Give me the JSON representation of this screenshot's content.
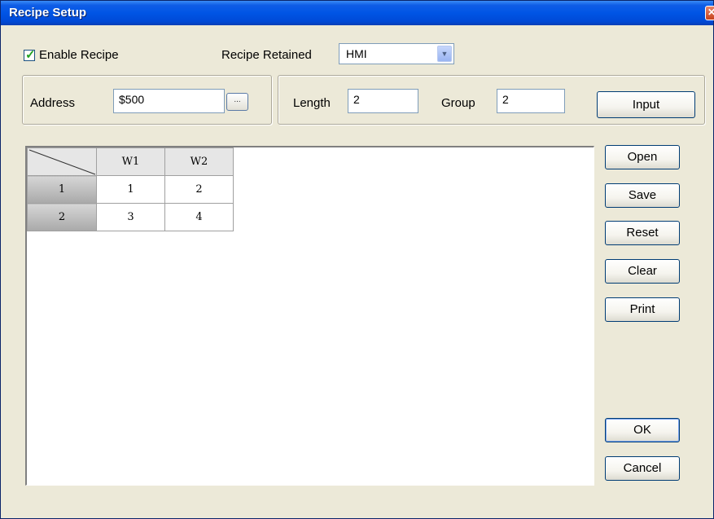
{
  "window": {
    "title": "Recipe Setup",
    "close_glyph": "✕"
  },
  "options": {
    "enable_recipe_label": "Enable Recipe",
    "enable_recipe_checked": true,
    "recipe_retained_label": "Recipe Retained",
    "recipe_retained_value": "HMI"
  },
  "address": {
    "label": "Address",
    "value": "$500",
    "browse_label": "..."
  },
  "size": {
    "length_label": "Length",
    "length_value": "2",
    "group_label": "Group",
    "group_value": "2",
    "input_button": "Input"
  },
  "table": {
    "columns": [
      "W1",
      "W2"
    ],
    "rows": [
      {
        "header": "1",
        "values": [
          "1",
          "2"
        ]
      },
      {
        "header": "2",
        "values": [
          "3",
          "4"
        ]
      }
    ]
  },
  "buttons": {
    "open": "Open",
    "save": "Save",
    "reset": "Reset",
    "clear": "Clear",
    "print": "Print",
    "ok": "OK",
    "cancel": "Cancel"
  },
  "icons": {
    "check": "check-icon",
    "dropdown": "chevron-down-icon",
    "close": "close-icon"
  },
  "colors": {
    "title_bar": "#0055e5",
    "dialog_bg": "#ece9d8",
    "button_border": "#003c74"
  }
}
